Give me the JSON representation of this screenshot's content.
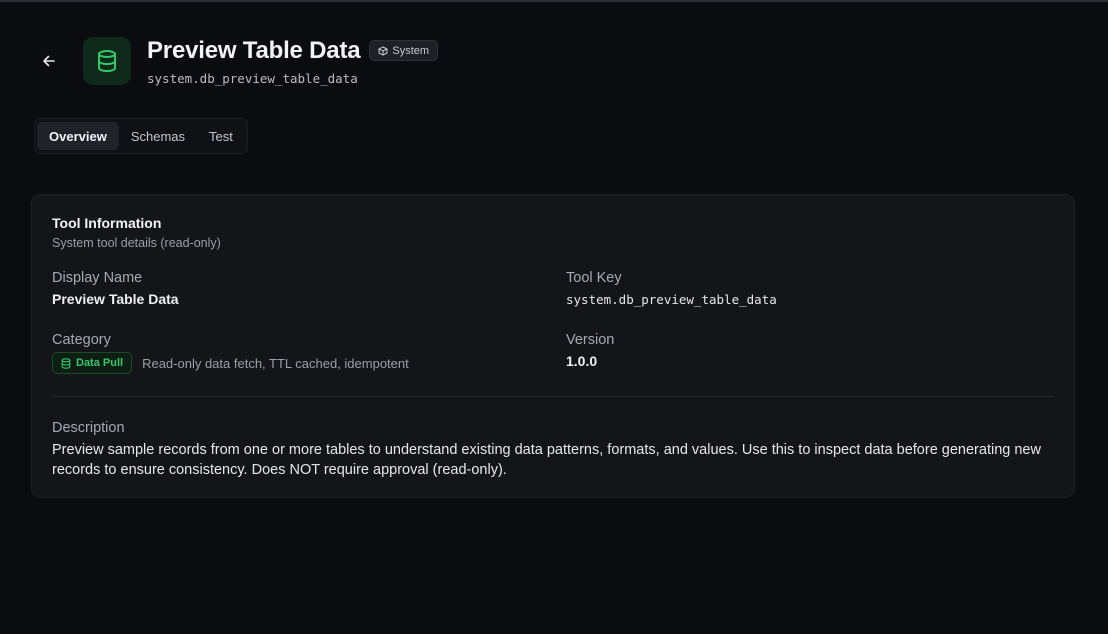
{
  "header": {
    "title": "Preview Table Data",
    "badge": "System",
    "tool_key": "system.db_preview_table_data",
    "back_icon": "arrow-left-icon",
    "tool_icon": "database-icon"
  },
  "tabs": [
    {
      "label": "Overview",
      "active": true
    },
    {
      "label": "Schemas",
      "active": false
    },
    {
      "label": "Test",
      "active": false
    }
  ],
  "card": {
    "title": "Tool Information",
    "subtitle": "System tool details (read-only)",
    "display_name_label": "Display Name",
    "display_name": "Preview Table Data",
    "tool_key_label": "Tool Key",
    "tool_key": "system.db_preview_table_data",
    "category_label": "Category",
    "category_badge": "Data Pull",
    "category_description": "Read-only data fetch, TTL cached, idempotent",
    "version_label": "Version",
    "version": "1.0.0",
    "description_label": "Description",
    "description": "Preview sample records from one or more tables to understand existing data patterns, formats, and values. Use this to inspect data before generating new records to ensure consistency. Does NOT require approval (read-only)."
  },
  "colors": {
    "background": "#0b0c0f",
    "card": "#131518",
    "accent_green": "#34c76a"
  }
}
